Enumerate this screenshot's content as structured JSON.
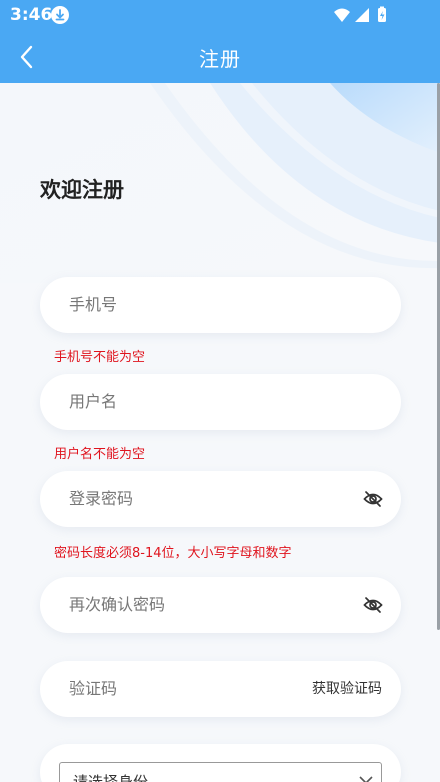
{
  "status_bar": {
    "time": "3:46"
  },
  "app_bar": {
    "title": "注册"
  },
  "page": {
    "heading": "欢迎注册"
  },
  "form": {
    "phone": {
      "placeholder": "手机号",
      "error": "手机号不能为空"
    },
    "username": {
      "placeholder": "用户名",
      "error": "用户名不能为空"
    },
    "password": {
      "placeholder": "登录密码",
      "error": "密码长度必须8-14位，大小写字母和数字"
    },
    "confirm_password": {
      "placeholder": "再次确认密码"
    },
    "code": {
      "placeholder": "验证码",
      "button_label": "获取验证码"
    },
    "identity": {
      "selected": "请选择身份"
    }
  },
  "colors": {
    "primary": "#4aa8f3",
    "error": "#e0141e"
  }
}
